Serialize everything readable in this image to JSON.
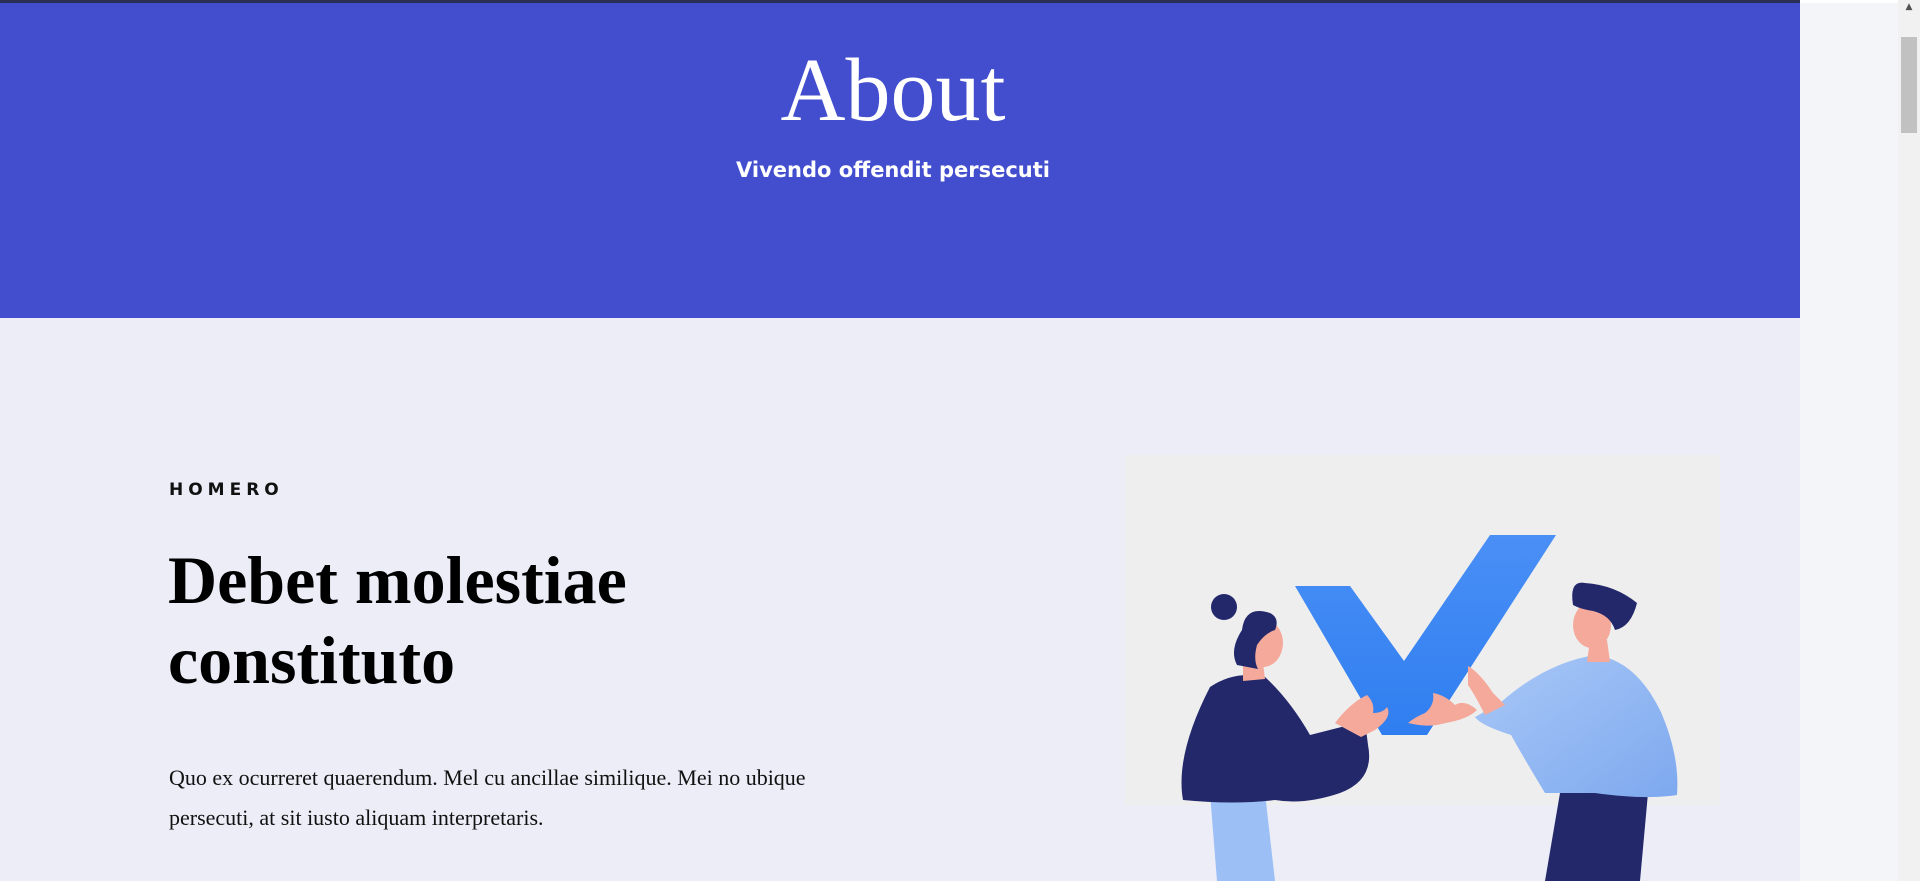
{
  "hero": {
    "title": "About",
    "subtitle": "Vivendo offendit persecuti"
  },
  "section": {
    "eyebrow": "HOMERO",
    "headline": "Debet molestiae constituto",
    "body": "Quo ex ocurreret quaerendum. Mel cu ancillae similique. Mei no ubique persecuti, at sit iusto aliquam interpretaris."
  },
  "colors": {
    "hero_background": "#434ecf",
    "content_background": "#ecedf7",
    "checkmark_blue": "#3d8bf5",
    "figure_navy": "#23286b",
    "figure_light_blue": "#9cc0f5",
    "skin": "#f4a99a"
  },
  "icons": {
    "scroll_up": "▲"
  }
}
